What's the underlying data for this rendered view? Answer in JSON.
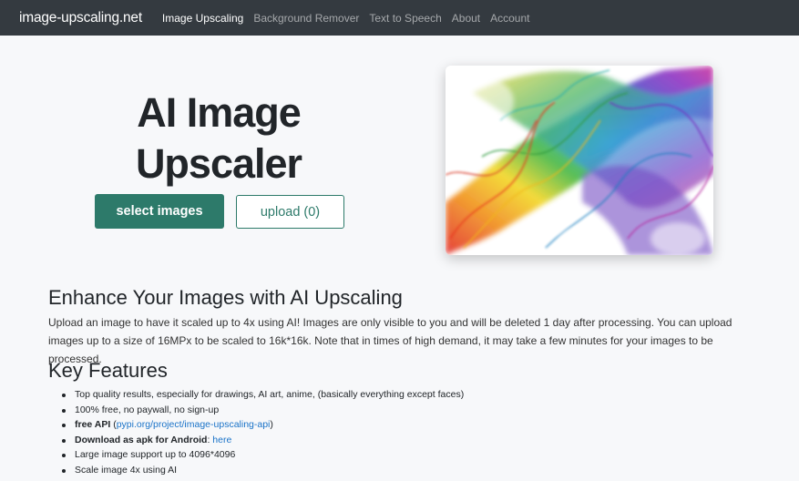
{
  "nav": {
    "brand": "image-upscaling.net",
    "links": [
      {
        "label": "Image Upscaling",
        "active": true
      },
      {
        "label": "Background Remover",
        "active": false
      },
      {
        "label": "Text to Speech",
        "active": false
      },
      {
        "label": "About",
        "active": false
      },
      {
        "label": "Account",
        "active": false
      }
    ]
  },
  "hero": {
    "title_line1": "AI Image",
    "title_line2": "Upscaler",
    "select_label": "select images",
    "upload_label": "upload (0)",
    "image_subject": "colorful-smoke-sample-image"
  },
  "intro": {
    "heading": "Enhance Your Images with AI Upscaling",
    "text": "Upload an image to have it scaled up to 4x using AI! Images are only visible to you and will be deleted 1 day after processing. You can upload images up to a size of 16MPx to be scaled to 16k*16k. Note that in times of high demand, it may take a few minutes for your images to be processed."
  },
  "features": {
    "heading": "Key Features",
    "items": [
      {
        "text": "Top quality results, especially for drawings, AI art, anime, (basically everything except faces)"
      },
      {
        "text": "100% free, no paywall, no sign-up"
      },
      {
        "bold": "free API",
        "pre": " (",
        "link": "pypi.org/project/image-upscaling-api",
        "post": ")"
      },
      {
        "bold": "Download as apk for Android",
        "pre": ": ",
        "link": "here",
        "post": ""
      },
      {
        "text": "Large image support up to 4096*4096"
      },
      {
        "text": "Scale image 4x using AI"
      }
    ]
  },
  "colors": {
    "navbar": "#343a40",
    "accent": "#2d7a6a",
    "link": "#1a73c8"
  }
}
